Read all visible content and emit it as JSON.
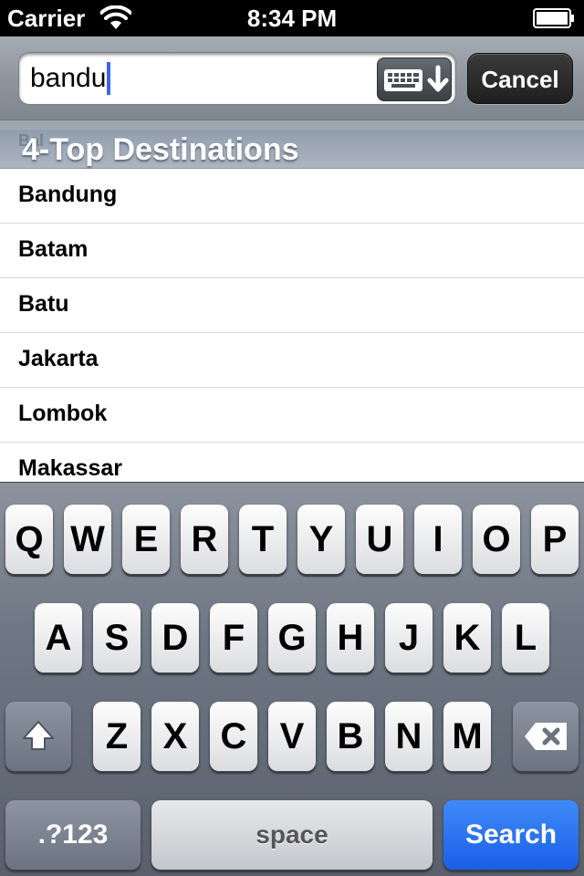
{
  "status_bar": {
    "carrier": "Carrier",
    "time": "8:34 PM"
  },
  "search": {
    "value": "bandu",
    "cancel_label": "Cancel"
  },
  "section": {
    "ghost_text": "Bal",
    "title": "4-Top Destinations"
  },
  "list": {
    "items": [
      "Bandung",
      "Batam",
      "Batu",
      "Jakarta",
      "Lombok",
      "Makassar"
    ]
  },
  "keyboard": {
    "row1": [
      "Q",
      "W",
      "E",
      "R",
      "T",
      "Y",
      "U",
      "I",
      "O",
      "P"
    ],
    "row2": [
      "A",
      "S",
      "D",
      "F",
      "G",
      "H",
      "J",
      "K",
      "L"
    ],
    "row3": [
      "Z",
      "X",
      "C",
      "V",
      "B",
      "N",
      "M"
    ],
    "numbers_label": ".?123",
    "space_label": "space",
    "search_label": "Search",
    "shift_icon": "shift-icon",
    "delete_icon": "backspace-icon"
  },
  "colors": {
    "accent": "#1a5fe8",
    "caret": "#3b66e6"
  }
}
